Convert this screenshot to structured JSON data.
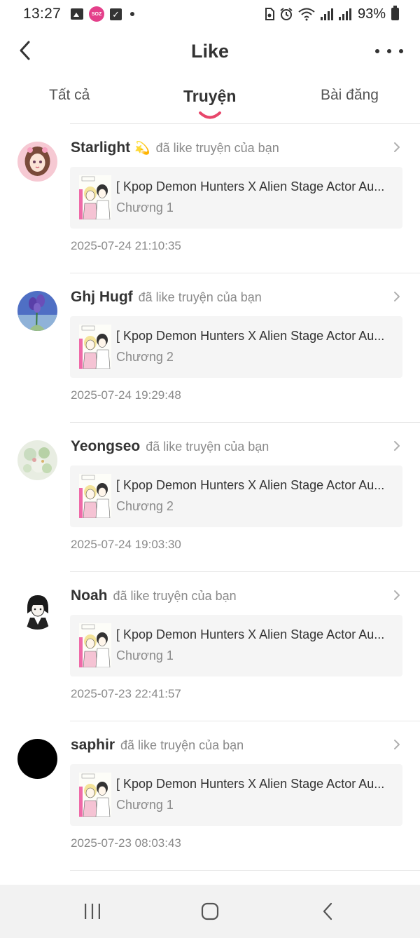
{
  "status_bar": {
    "time": "13:27",
    "app_badge": "SOZ",
    "battery": "93%",
    "icons": [
      "gallery-icon",
      "app-icon",
      "check-icon",
      "dot-icon",
      "sim-icon",
      "alarm-icon",
      "wifi-icon",
      "signal-icon",
      "signal-icon",
      "battery-icon"
    ]
  },
  "header": {
    "title": "Like"
  },
  "tabs": [
    {
      "label": "Tất cả",
      "active": false
    },
    {
      "label": "Truyện",
      "active": true
    },
    {
      "label": "Bài đăng",
      "active": false
    }
  ],
  "accent_color": "#e8476b",
  "items": [
    {
      "user": "Starlight",
      "emoji": "💫",
      "action": "đã like truyện của bạn",
      "story_title": "[ Kpop Demon Hunters X Alien Stage Actor Au...",
      "chapter": "Chương 1",
      "timestamp": "2025-07-24 21:10:35"
    },
    {
      "user": "Ghj Hugf",
      "emoji": "",
      "action": "đã like truyện của bạn",
      "story_title": "[ Kpop Demon Hunters X Alien Stage Actor Au...",
      "chapter": "Chương 2",
      "timestamp": "2025-07-24 19:29:48"
    },
    {
      "user": "Yeongseo",
      "emoji": "",
      "action": "đã like truyện của bạn",
      "story_title": "[ Kpop Demon Hunters X Alien Stage Actor Au...",
      "chapter": "Chương 2",
      "timestamp": "2025-07-24 19:03:30"
    },
    {
      "user": "Noah",
      "emoji": "",
      "action": "đã like truyện của bạn",
      "story_title": "[ Kpop Demon Hunters X Alien Stage Actor Au...",
      "chapter": "Chương 1",
      "timestamp": "2025-07-23 22:41:57"
    },
    {
      "user": "saphir",
      "emoji": "",
      "action": "đã like truyện của bạn",
      "story_title": "[ Kpop Demon Hunters X Alien Stage Actor Au...",
      "chapter": "Chương 1",
      "timestamp": "2025-07-23 08:03:43"
    }
  ],
  "nav_bar": {
    "icons": [
      "recent-apps-icon",
      "home-icon",
      "back-icon"
    ]
  }
}
